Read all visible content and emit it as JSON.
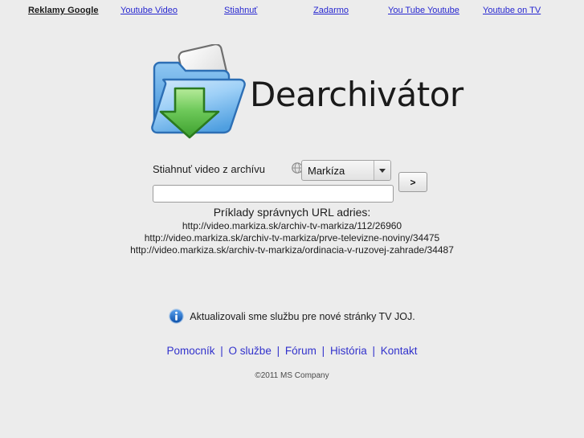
{
  "adbar": {
    "label": "Reklamy Google",
    "links": [
      "Youtube Video",
      "Stiahnuť",
      "Zadarmo",
      "You Tube Youtube",
      "Youtube on TV"
    ]
  },
  "logo": {
    "text": "Dearchivátor",
    "icon": "folder-download-icon"
  },
  "form": {
    "label": "Stiahnuť video z archívu",
    "globe_icon": "globe-icon",
    "selected_source": "Markíza",
    "submit_label": ">",
    "url_value": "",
    "url_placeholder": ""
  },
  "examples": {
    "title": "Príklady správnych URL adries:",
    "urls": [
      "http://video.markiza.sk/archiv-tv-markiza/112/26960",
      "http://video.markiza.sk/archiv-tv-markiza/prve-televizne-noviny/34475",
      "http://video.markiza.sk/archiv-tv-markiza/ordinacia-v-ruzovej-zahrade/34487"
    ]
  },
  "notice": {
    "icon": "info-icon",
    "text": "Aktualizovali sme službu pre nové stránky TV JOJ."
  },
  "footer": {
    "links": [
      "Pomocník",
      "O službe",
      "Fórum",
      "História",
      "Kontakt"
    ],
    "separator": "|",
    "copyright": "©2011 MS Company"
  },
  "colors": {
    "background": "#ececec",
    "link_blue": "#2727d0",
    "footer_link_blue": "#3232cc",
    "text_dark": "#1c1c1c",
    "folder_blue": "#5aa7e8",
    "arrow_green": "#5ec44f",
    "info_blue": "#1a6fd4"
  }
}
